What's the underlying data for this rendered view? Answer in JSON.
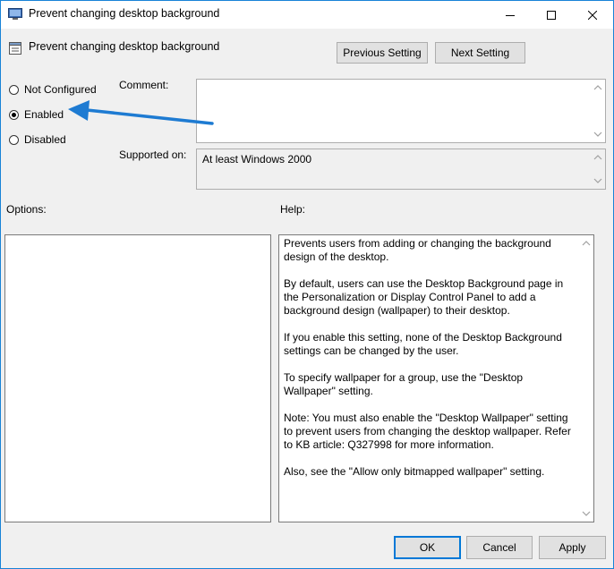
{
  "window": {
    "title": "Prevent changing desktop background",
    "minimize_glyph": "—",
    "maximize_glyph": "☐",
    "close_glyph": "✕"
  },
  "header": {
    "setting_name": "Prevent changing desktop background",
    "prev_label": "Previous Setting",
    "next_label": "Next Setting"
  },
  "state": {
    "options": [
      {
        "label": "Not Configured",
        "checked": false
      },
      {
        "label": "Enabled",
        "checked": true
      },
      {
        "label": "Disabled",
        "checked": false
      }
    ]
  },
  "comment": {
    "label": "Comment:",
    "value": ""
  },
  "supported": {
    "label": "Supported on:",
    "value": "At least Windows 2000"
  },
  "options_panel": {
    "label": "Options:"
  },
  "help_panel": {
    "label": "Help:",
    "paragraphs": [
      "Prevents users from adding or changing the background design of the desktop.",
      "By default, users can use the Desktop Background page in the Personalization or Display Control Panel to add a background design (wallpaper) to their desktop.",
      "If you enable this setting, none of the Desktop Background settings can be changed by the user.",
      "To specify wallpaper for a group, use the \"Desktop Wallpaper\" setting.",
      "Note: You must also enable the \"Desktop Wallpaper\" setting to prevent users from changing the desktop wallpaper. Refer to KB article: Q327998 for more information.",
      "Also, see the \"Allow only bitmapped wallpaper\" setting."
    ]
  },
  "footer": {
    "ok_label": "OK",
    "cancel_label": "Cancel",
    "apply_label": "Apply"
  },
  "colors": {
    "accent": "#0078d7",
    "arrow": "#1e7bd2"
  }
}
